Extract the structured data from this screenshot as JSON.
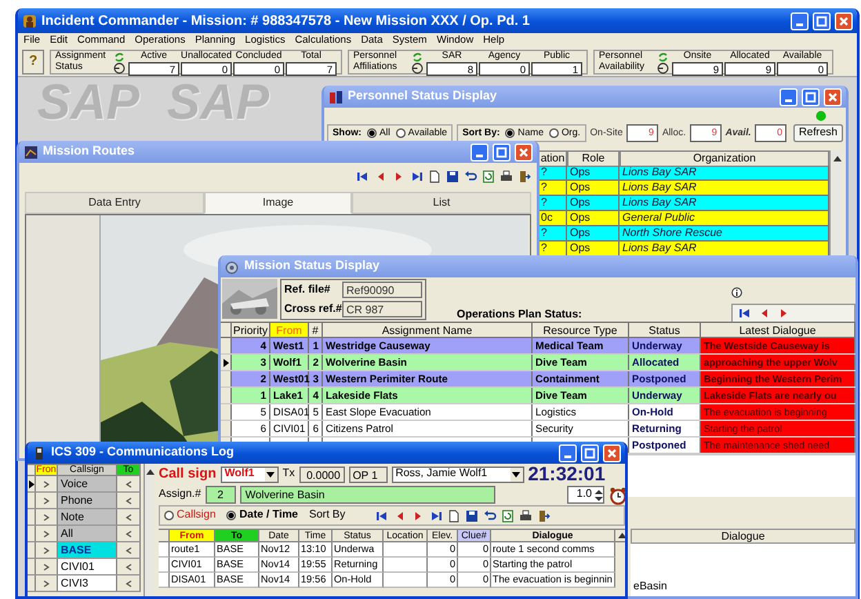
{
  "main_window": {
    "title": "Incident Commander - Mission: # 988347578 - New Mission XXX / Op. Pd. 1",
    "active": true
  },
  "menu": [
    "File",
    "Edit",
    "Command",
    "Operations",
    "Planning",
    "Logistics",
    "Calculations",
    "Data",
    "System",
    "Window",
    "Help"
  ],
  "toolbar": {
    "help_label": "?",
    "groups": [
      {
        "label": "Assignment Status",
        "fields": [
          {
            "label": "Active",
            "value": "7"
          },
          {
            "label": "Unallocated",
            "value": "0"
          },
          {
            "label": "Concluded",
            "value": "0"
          },
          {
            "label": "Total",
            "value": "7"
          }
        ]
      },
      {
        "label": "Personnel Affiliations",
        "fields": [
          {
            "label": "SAR",
            "value": "8"
          },
          {
            "label": "Agency",
            "value": "0"
          },
          {
            "label": "Public",
            "value": "1"
          }
        ]
      },
      {
        "label": "Personnel Availability",
        "fields": [
          {
            "label": "Onsite",
            "value": "9"
          },
          {
            "label": "Allocated",
            "value": "9"
          },
          {
            "label": "Available",
            "value": "0"
          }
        ]
      }
    ]
  },
  "desktop": {
    "logo_texts": [
      "SAP",
      "SAP"
    ]
  },
  "personnel_window": {
    "title": "Personnel Status Display",
    "active": false,
    "show_label": "Show:",
    "show_options": [
      {
        "label": "All",
        "selected": true
      },
      {
        "label": "Available",
        "selected": false
      }
    ],
    "sort_label": "Sort By:",
    "sort_options": [
      {
        "label": "Name",
        "selected": true
      },
      {
        "label": "Org.",
        "selected": false
      }
    ],
    "counters": [
      {
        "label": "On-Site",
        "value": "9",
        "bold": false
      },
      {
        "label": "Alloc.",
        "value": "9",
        "bold": false
      },
      {
        "label": "Avail.",
        "value": "0",
        "bold": true
      }
    ],
    "refresh_label": "Refresh",
    "columns": [
      "ation",
      "Role",
      "Organization"
    ],
    "rows": [
      {
        "cells": [
          "?",
          "Ops",
          "Lions Bay SAR"
        ],
        "color": "#00ffff"
      },
      {
        "cells": [
          "?",
          "Ops",
          "Lions Bay SAR"
        ],
        "color": "#ffff00"
      },
      {
        "cells": [
          "?",
          "Ops",
          "Lions Bay SAR"
        ],
        "color": "#00ffff"
      },
      {
        "cells": [
          "0c",
          "Ops",
          "General Public"
        ],
        "color": "#ffff00"
      },
      {
        "cells": [
          "?",
          "Ops",
          "North Shore Rescue"
        ],
        "color": "#00ffff"
      },
      {
        "cells": [
          "?",
          "Ops",
          "Lions Bay SAR"
        ],
        "color": "#ffff00"
      }
    ]
  },
  "routes_window": {
    "title": "Mission Routes",
    "active": false,
    "tabs": [
      {
        "label": "Data Entry",
        "selected": false
      },
      {
        "label": "Image",
        "selected": true
      },
      {
        "label": "List",
        "selected": false
      }
    ]
  },
  "status_window": {
    "title": "Mission Status Display",
    "active": false,
    "ref_label": "Ref. file#",
    "ref_value": "Ref90090",
    "cross_label": "Cross ref.#",
    "cross_value": "CR 987",
    "plan_label": "Operations Plan Status:",
    "columns": [
      "Priority",
      "From",
      "#",
      "Assignment Name",
      "Resource Type",
      "Status",
      "Latest Dialogue"
    ],
    "rows": [
      {
        "selected": false,
        "emphasis": true,
        "color": "#a0a0f8",
        "priority": "4",
        "from": "West1",
        "num": "1",
        "name": "Westridge Causeway",
        "resource": "Medical Team",
        "status": "Underway",
        "dialogue": "The Westside Causeway is"
      },
      {
        "selected": true,
        "emphasis": true,
        "color": "#a8f8a8",
        "priority": "3",
        "from": "Wolf1",
        "num": "2",
        "name": "Wolverine Basin",
        "resource": "Dive Team",
        "status": "Allocated",
        "dialogue": "approaching the upper Wolv"
      },
      {
        "selected": false,
        "emphasis": true,
        "color": "#a0a0f8",
        "priority": "2",
        "from": "West01",
        "num": "3",
        "name": "Western Perimiter Route",
        "resource": "Containment",
        "status": "Postponed",
        "dialogue": "Beginning the Western Perim"
      },
      {
        "selected": false,
        "emphasis": true,
        "color": "#a8f8a8",
        "priority": "1",
        "from": "Lake1",
        "num": "4",
        "name": "Lakeside Flats",
        "resource": "Dive Team",
        "status": "Underway",
        "dialogue": "Lakeside Flats are nearly ou"
      },
      {
        "selected": false,
        "emphasis": false,
        "color": "#ffffff",
        "priority": "5",
        "from": "DISA01",
        "num": "5",
        "name": "East Slope Evacuation",
        "resource": "Logistics",
        "status": "On-Hold",
        "dialogue": "The evacuation is beginning"
      },
      {
        "selected": false,
        "emphasis": false,
        "color": "#ffffff",
        "priority": "6",
        "from": "CIVI01",
        "num": "6",
        "name": "Citizens Patrol",
        "resource": "Security",
        "status": "Returning",
        "dialogue": "Starting the patrol"
      },
      {
        "emphasis": false,
        "color": "#ffffff",
        "status": "Postponed",
        "dialogue": "The maintenance shed need"
      }
    ],
    "lower_columns": [
      "Dialogue"
    ],
    "lower_cells": [
      "eBasin"
    ]
  },
  "comms_window": {
    "title": "ICS 309 - Communications Log",
    "active": true,
    "list_columns": [
      "Fron",
      "Callsign",
      "To"
    ],
    "channels": [
      {
        "name": "Voice",
        "kind": "channel",
        "selected": false,
        "current": true
      },
      {
        "name": "Phone",
        "kind": "channel",
        "selected": false,
        "current": false
      },
      {
        "name": "Note",
        "kind": "channel",
        "selected": false,
        "current": false
      },
      {
        "name": "All",
        "kind": "channel",
        "selected": false,
        "current": false
      },
      {
        "name": "BASE",
        "kind": "callsign",
        "selected": true,
        "current": false
      },
      {
        "name": "CIVI01",
        "kind": "callsign",
        "selected": false,
        "current": false
      },
      {
        "name": "CIVI3",
        "kind": "callsign",
        "selected": false,
        "current": false
      }
    ],
    "call_sign_label": "Call sign",
    "call_sign": "Wolf1",
    "tx_label": "Tx",
    "tx_value": "0.0000",
    "op_value": "OP 1",
    "operator": "Ross, Jamie Wolf1",
    "clock": "21:32:01",
    "assign_label": "Assign.#",
    "assign_num": "2",
    "assign_name": "Wolverine Basin",
    "interval": "1.0",
    "sort_options": [
      {
        "label": "Callsign",
        "selected": false
      },
      {
        "label": "Date / Time",
        "selected": true
      }
    ],
    "sort_label": "Sort By",
    "log_columns": [
      "From",
      "To",
      "Date",
      "Time",
      "Status",
      "Location",
      "Elev.",
      "Clue#",
      "Dialogue"
    ],
    "log_rows": [
      {
        "cells": [
          "route1",
          "BASE",
          "Nov12",
          "13:10",
          "Underwa",
          "",
          "0",
          "0",
          "route 1 second comms"
        ]
      },
      {
        "cells": [
          "CIVI01",
          "BASE",
          "Nov14",
          "19:55",
          "Returning",
          "",
          "0",
          "0",
          "Starting the patrol"
        ]
      },
      {
        "cells": [
          "DISA01",
          "BASE",
          "Nov14",
          "19:56",
          "On-Hold",
          "",
          "0",
          "0",
          "The evacuation is beginnin"
        ]
      }
    ]
  }
}
